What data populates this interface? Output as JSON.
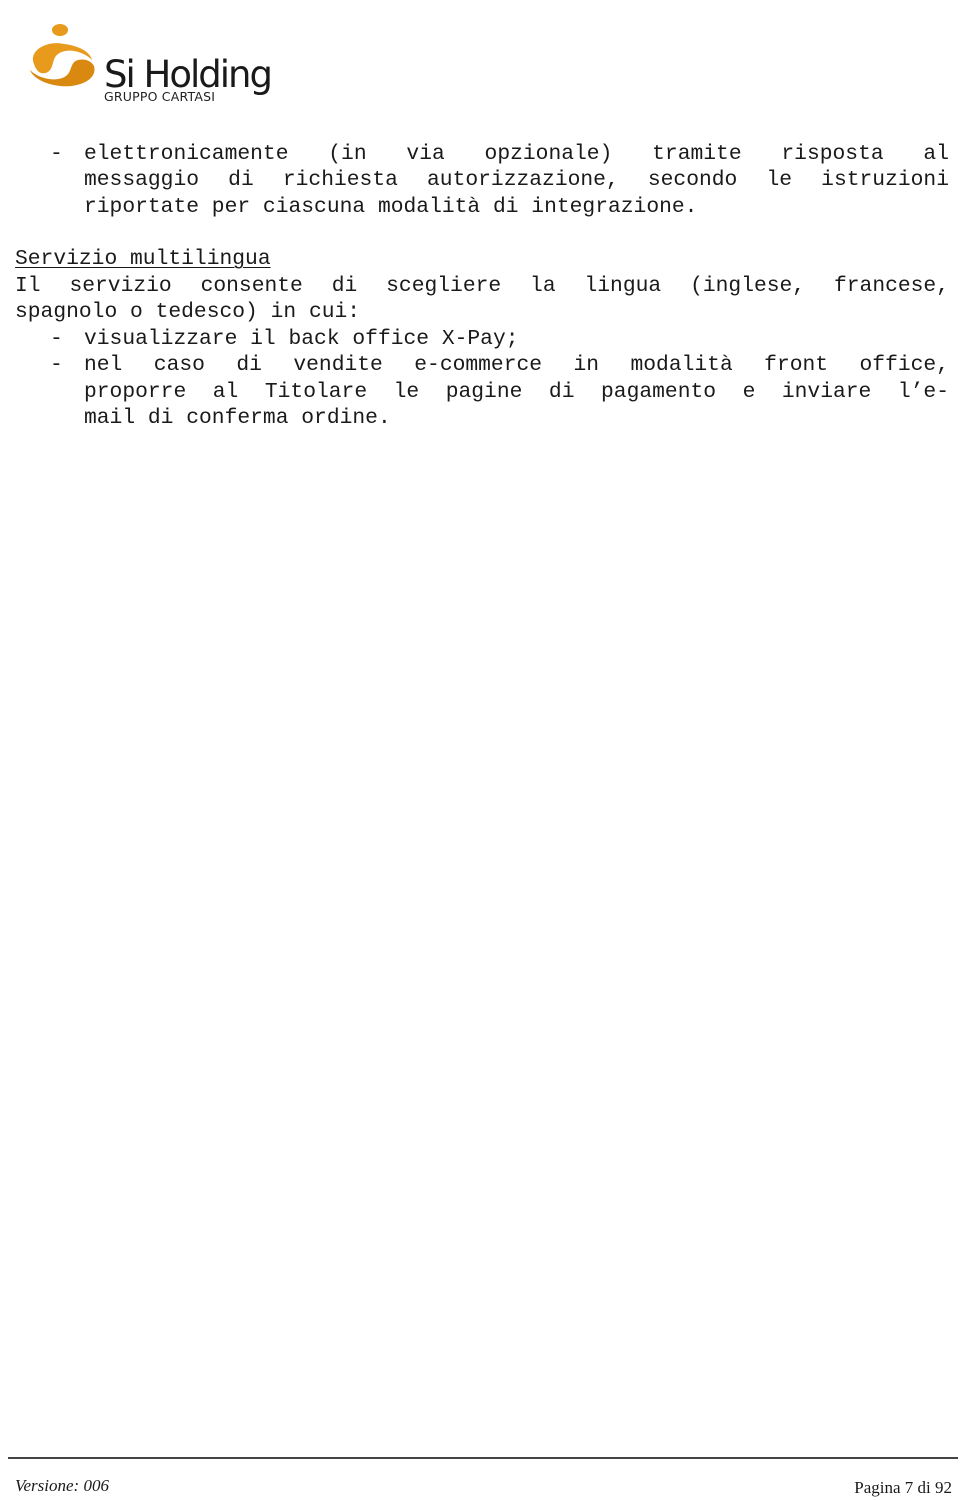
{
  "header": {
    "logo": {
      "name": "Si Holding",
      "subtitle": "GRUPPO CARTASI",
      "icon": "si-holding-swirl-logo-icon",
      "colors": {
        "orange": "#e89a1c",
        "orange_dark": "#c8780a",
        "text": "#1a1a1a"
      }
    }
  },
  "body": {
    "intro_bullet": {
      "dash": "-",
      "lines": [
        "elettronicamente (in via opzionale) tramite risposta al",
        "messaggio di richiesta autorizzazione, secondo le istruzioni",
        "riportate per ciascuna modalità di integrazione."
      ]
    },
    "section": {
      "heading": "Servizio multilingua",
      "paragraph_lines": [
        "Il servizio consente di scegliere la lingua (inglese, francese,",
        "spagnolo o tedesco) in cui:"
      ],
      "bullets": [
        {
          "dash": "-",
          "lines": [
            "visualizzare il back office X-Pay;"
          ]
        },
        {
          "dash": "-",
          "lines": [
            "nel caso di vendite e-commerce in modalità front office,",
            "proporre al Titolare le pagine di pagamento e inviare l’e-",
            "mail di conferma ordine."
          ]
        }
      ]
    }
  },
  "footer": {
    "version": "Versione: 006",
    "page": "Pagina 7 di 92"
  }
}
